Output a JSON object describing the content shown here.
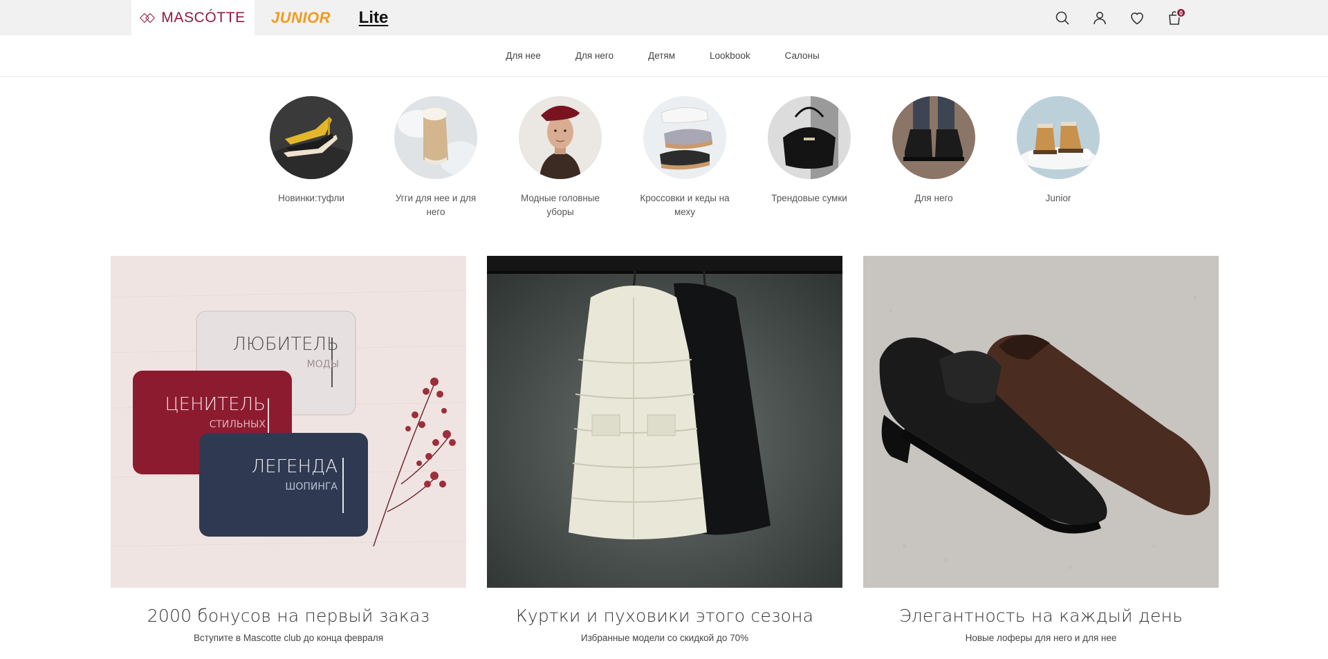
{
  "brands": {
    "mascotte": "MASCÓTTE",
    "junior": "JUNIOR",
    "lite": "Lite"
  },
  "header_icons": {
    "search": "search-icon",
    "account": "user-icon",
    "favorites": "heart-icon",
    "cart": "bag-icon",
    "cart_count": "0"
  },
  "nav": {
    "items": [
      {
        "label": "Для нее"
      },
      {
        "label": "Для него"
      },
      {
        "label": "Детям"
      },
      {
        "label": "Lookbook"
      },
      {
        "label": "Салоны"
      }
    ]
  },
  "stories": [
    {
      "label": "Новинки:туфли"
    },
    {
      "label": "Угги для нее и для него"
    },
    {
      "label": "Модные головные уборы"
    },
    {
      "label": "Кроссовки и кеды на меху"
    },
    {
      "label": "Трендовые сумки"
    },
    {
      "label": "Для него"
    },
    {
      "label": "Junior"
    }
  ],
  "banners": [
    {
      "title": "2000 бонусов на первый заказ",
      "subtitle": "Вступите в Mascotte club до конца февраля",
      "cards": [
        {
          "line1": "ЛЮБИТЕЛЬ",
          "line2": "МОДЫ"
        },
        {
          "line1": "ЦЕНИТЕЛЬ",
          "line2": "СТИЛЬНЫХ"
        },
        {
          "line1": "ЛЕГЕНДА",
          "line2": "ШОПИНГА"
        }
      ]
    },
    {
      "title": "Куртки и пуховики этого сезона",
      "subtitle": "Избранные модели со скидкой до 70%"
    },
    {
      "title": "Элегантность на каждый день",
      "subtitle": "Новые лоферы для него и для нее"
    }
  ],
  "colors": {
    "brand": "#8e1b3e",
    "junior": "#f29a1f",
    "topbar": "#f1f1f1"
  }
}
